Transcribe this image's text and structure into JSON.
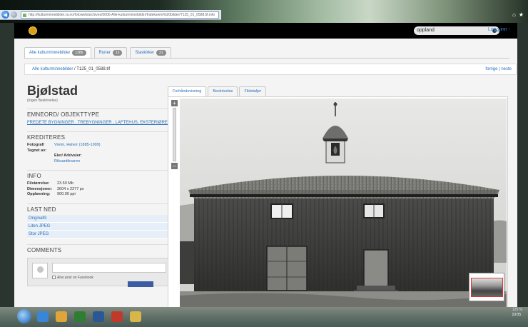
{
  "browser": {
    "url": "http://kulturminnebilder.ra.no/fotoweb/archives/5000-Alle-kulturminnebilder/Indekserte%20bilder/T125_01_0588.tif.info"
  },
  "site": {
    "search_value": "oppland",
    "login_label": "Logg inn -"
  },
  "archive_tabs": [
    {
      "label": "Alle kulturminnebilder",
      "count": "1286"
    },
    {
      "label": "Runer",
      "count": "13"
    },
    {
      "label": "Stavkirker",
      "count": "21"
    }
  ],
  "breadcrumb": {
    "root": "Alle kulturminnebilder",
    "separator": "/",
    "current": "T125_01_0588.tif",
    "pager": "forrige | neste"
  },
  "record": {
    "title": "Bjølstad",
    "subtitle": "(Ingen Beskrivelse)",
    "keywords_head": "EMNEORD/ OBJEKTTYPE",
    "keywords": "FREDETE BYGNINGER , TREBYGNINGER , LAFTEHUS, EKSTERIØRER",
    "credits_head": "KREDITERES",
    "credits": [
      {
        "k": "Fotograf/ Tegnet av:",
        "v": "Vreim, Halvor (1885-1999)",
        "link": true
      },
      {
        "k": "",
        "v": "Eier/ Arkivsier:",
        "link": false
      },
      {
        "k": "",
        "v": "Riksantikvaren",
        "link": true
      }
    ],
    "info_head": "INFO",
    "info": [
      {
        "k": "Filstørrelse:",
        "v": "23.50 Mb"
      },
      {
        "k": "Dimensjoner:",
        "v": "3604 x 2277 px"
      },
      {
        "k": "Oppløsning:",
        "v": "900.00 ppi"
      }
    ],
    "download_head": "LAST NED",
    "downloads": [
      "Originalfil",
      "Liten JPEG",
      "Stor JPEG"
    ],
    "comments_head": "COMMENTS",
    "fb_label": "Also post on Facebook"
  },
  "viewer_tabs": [
    "Forhåndsvisning",
    "Beskrivelse",
    "Fildetaljer"
  ],
  "zoom": {
    "plus": "+",
    "minus": "–"
  },
  "taskbar": {
    "zoom_level": "125 %",
    "time": "10:05"
  }
}
